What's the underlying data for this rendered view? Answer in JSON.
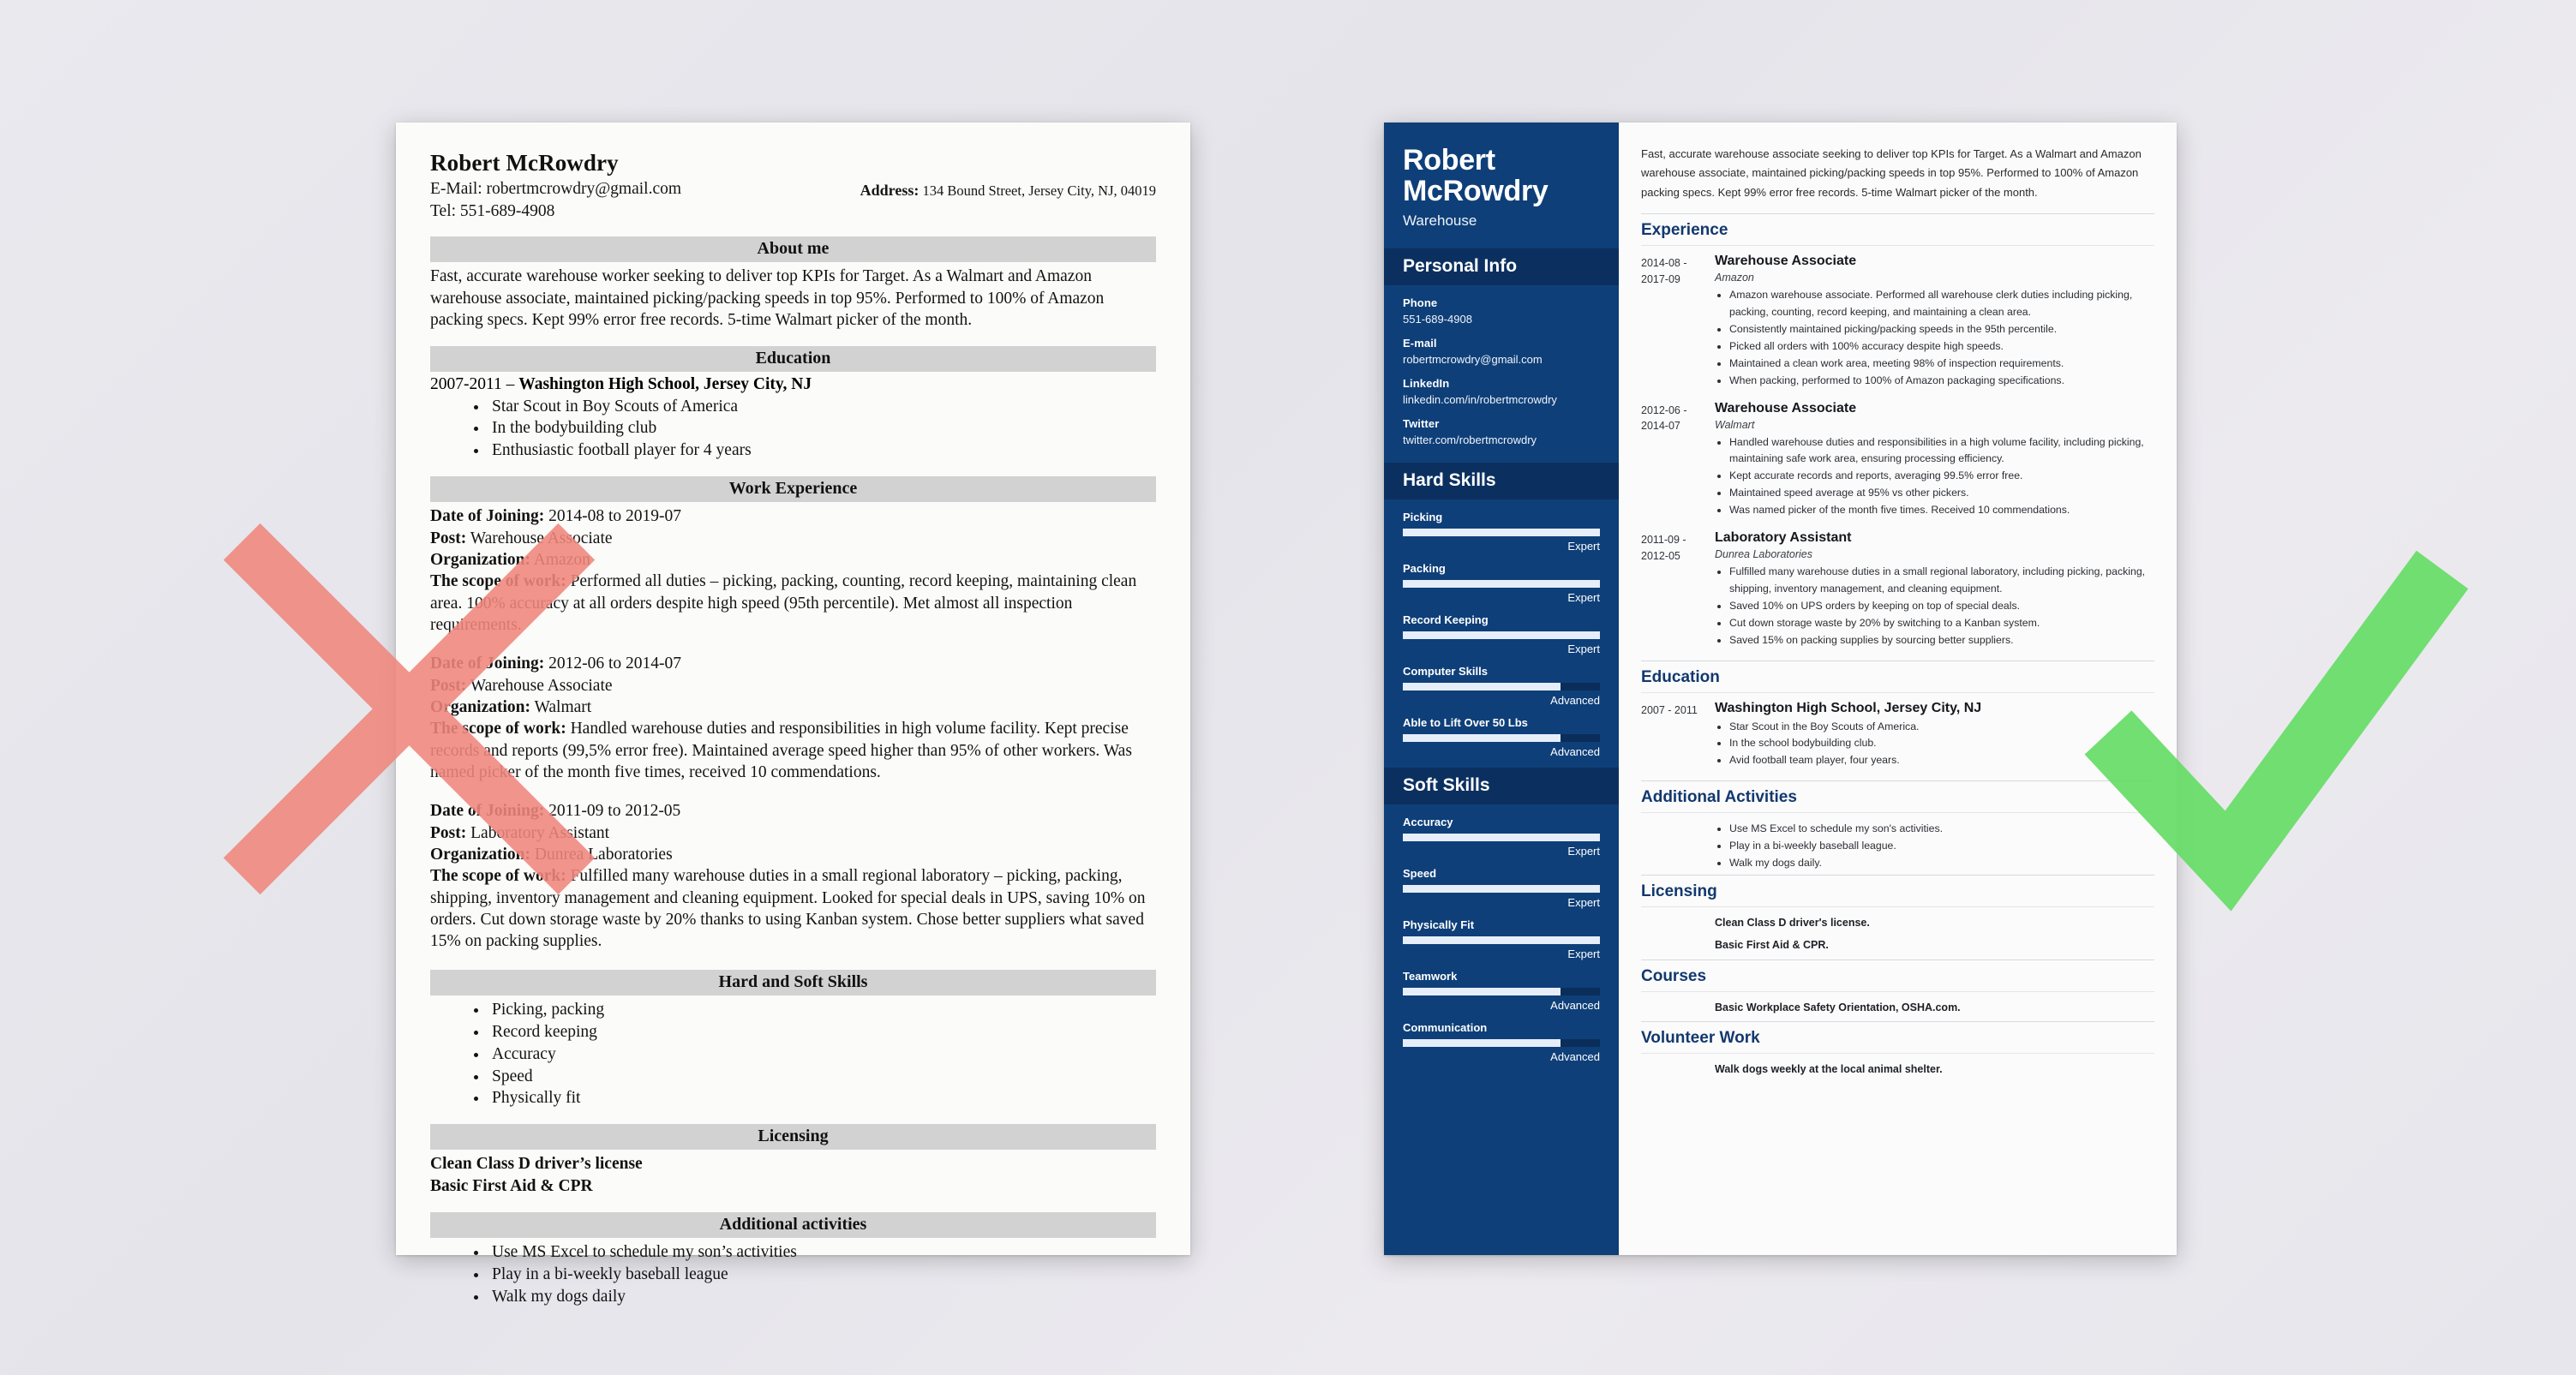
{
  "colors": {
    "sidebar_blue": "#0e3f79",
    "sidebar_head_blue": "#0b3060",
    "heading_blue": "#12386e",
    "band_gray": "#d2d2d2",
    "mark_red": "#f08a80",
    "mark_green": "#66dd66",
    "page_bg": "#e9e9ee"
  },
  "bad_resume": {
    "name": "Robert McRowdry",
    "email_line": "E-Mail: robertmcrowdry@gmail.com",
    "tel_line": "Tel: 551-689-4908",
    "address_label": "Address:",
    "address_value": "134 Bound Street, Jersey City, NJ, 04019",
    "about": {
      "heading": "About me",
      "text": "Fast, accurate warehouse worker seeking to deliver top KPIs for Target. As a Walmart and Amazon warehouse associate, maintained picking/packing speeds in top 95%. Performed to 100% of Amazon packing specs. Kept 99% error free records. 5-time Walmart picker of the month."
    },
    "education": {
      "heading": "Education",
      "school_line_years": "2007-2011 – ",
      "school_line_name": "Washington High School, Jersey City, NJ",
      "bullets": [
        "Star Scout in Boy Scouts of America",
        "In the bodybuilding club",
        "Enthusiastic football player for 4 years"
      ]
    },
    "work": {
      "heading": "Work Experience",
      "labels": {
        "date": "Date of Joining:",
        "post": "Post:",
        "org": "Organization:",
        "scope": "The scope of work:"
      },
      "jobs": [
        {
          "date": " 2014-08 to 2019-07",
          "post": " Warehouse Associate",
          "org": " Amazon",
          "scope": " Performed all duties – picking, packing, counting, record keeping, maintaining clean area. 100% accuracy at all orders despite high speed (95th percentile). Met almost all inspection requirements."
        },
        {
          "date": " 2012-06 to 2014-07",
          "post": " Warehouse Associate",
          "org": " Walmart",
          "scope": " Handled warehouse duties and responsibilities in high volume facility. Kept precise records and reports (99,5% error free). Maintained average speed higher than 95% of other workers. Was named picker of the month five times, received 10 commendations."
        },
        {
          "date": " 2011-09 to 2012-05",
          "post": " Laboratory Assistant",
          "org": " Dunrea Laboratories",
          "scope": " Fulfilled many warehouse duties in a small regional laboratory – picking, packing, shipping, inventory management and cleaning equipment. Looked for special deals in UPS, saving 10% on orders. Cut down storage waste by 20% thanks to using Kanban system. Chose better suppliers what saved 15% on packing supplies."
        }
      ]
    },
    "skills": {
      "heading": "Hard and Soft Skills",
      "bullets": [
        "Picking, packing",
        "Record keeping",
        "Accuracy",
        "Speed",
        "Physically fit"
      ]
    },
    "licensing": {
      "heading": "Licensing",
      "lines": [
        "Clean Class D driver’s license",
        "Basic First Aid & CPR"
      ]
    },
    "additional": {
      "heading": "Additional activities",
      "bullets": [
        "Use MS Excel to schedule my son’s activities",
        "Play in a bi-weekly baseball league",
        "Walk my dogs daily"
      ]
    }
  },
  "good_resume": {
    "sidebar": {
      "name": "Robert McRowdry",
      "role": "Warehouse",
      "personal_info": {
        "heading": "Personal Info",
        "fields": [
          {
            "label": "Phone",
            "value": "551-689-4908"
          },
          {
            "label": "E-mail",
            "value": "robertmcrowdry@gmail.com"
          },
          {
            "label": "LinkedIn",
            "value": "linkedin.com/in/robertmcrowdry"
          },
          {
            "label": "Twitter",
            "value": "twitter.com/robertmcrowdry"
          }
        ]
      },
      "hard_skills": {
        "heading": "Hard Skills",
        "items": [
          {
            "name": "Picking",
            "level": "Expert",
            "pct": 100
          },
          {
            "name": "Packing",
            "level": "Expert",
            "pct": 100
          },
          {
            "name": "Record Keeping",
            "level": "Expert",
            "pct": 100
          },
          {
            "name": "Computer Skills",
            "level": "Advanced",
            "pct": 80
          },
          {
            "name": "Able to Lift Over 50 Lbs",
            "level": "Advanced",
            "pct": 80
          }
        ]
      },
      "soft_skills": {
        "heading": "Soft Skills",
        "items": [
          {
            "name": "Accuracy",
            "level": "Expert",
            "pct": 100
          },
          {
            "name": "Speed",
            "level": "Expert",
            "pct": 100
          },
          {
            "name": "Physically Fit",
            "level": "Expert",
            "pct": 100
          },
          {
            "name": "Teamwork",
            "level": "Advanced",
            "pct": 80
          },
          {
            "name": "Communication",
            "level": "Advanced",
            "pct": 80
          }
        ]
      }
    },
    "main": {
      "summary": "Fast, accurate warehouse associate seeking to deliver top KPIs for Target. As a Walmart and Amazon warehouse associate, maintained picking/packing speeds in top 95%. Performed to 100% of Amazon packing specs. Kept 99% error free records. 5-time Walmart picker of the month.",
      "experience": {
        "heading": "Experience",
        "entries": [
          {
            "dates": "2014-08 - 2017-09",
            "title": "Warehouse Associate",
            "org": "Amazon",
            "bullets": [
              "Amazon warehouse associate. Performed all warehouse clerk duties including picking, packing, counting, record keeping, and maintaining a clean area.",
              "Consistently maintained picking/packing speeds in the 95th percentile.",
              "Picked all orders with 100% accuracy despite high speeds.",
              "Maintained a clean work area, meeting 98% of inspection requirements.",
              "When packing, performed to 100% of Amazon packaging specifications."
            ]
          },
          {
            "dates": "2012-06 - 2014-07",
            "title": "Warehouse Associate",
            "org": "Walmart",
            "bullets": [
              "Handled warehouse duties and responsibilities in a high volume facility, including picking, maintaining safe work area, ensuring processing efficiency.",
              "Kept accurate records and reports, averaging 99.5% error free.",
              "Maintained speed average at 95% vs other pickers.",
              "Was named picker of the month five times. Received 10 commendations."
            ]
          },
          {
            "dates": "2011-09 - 2012-05",
            "title": "Laboratory Assistant",
            "org": "Dunrea Laboratories",
            "bullets": [
              "Fulfilled many warehouse duties in a small regional laboratory, including picking, packing, shipping, inventory management, and cleaning equipment.",
              "Saved 10% on UPS orders by keeping on top of special deals.",
              "Cut down storage waste by 20% by switching to a Kanban system.",
              "Saved 15% on packing supplies by sourcing better suppliers."
            ]
          }
        ]
      },
      "education": {
        "heading": "Education",
        "entries": [
          {
            "dates": "2007 - 2011",
            "title": "Washington High School, Jersey City, NJ",
            "bullets": [
              "Star Scout in the Boy Scouts of America.",
              "In the school bodybuilding club.",
              "Avid football team player, four years."
            ]
          }
        ]
      },
      "additional_activities": {
        "heading": "Additional Activities",
        "bullets": [
          "Use MS Excel to schedule my son's activities.",
          "Play in a bi-weekly baseball league.",
          "Walk my dogs daily."
        ]
      },
      "licensing": {
        "heading": "Licensing",
        "lines": [
          "Clean Class D driver's license.",
          "Basic First Aid & CPR."
        ]
      },
      "courses": {
        "heading": "Courses",
        "lines": [
          "Basic Workplace Safety Orientation, OSHA.com."
        ]
      },
      "volunteer": {
        "heading": "Volunteer Work",
        "lines": [
          "Walk dogs weekly at the local animal shelter."
        ]
      }
    }
  },
  "marks": {
    "bad": "red-x-mark",
    "good": "green-check-mark"
  }
}
